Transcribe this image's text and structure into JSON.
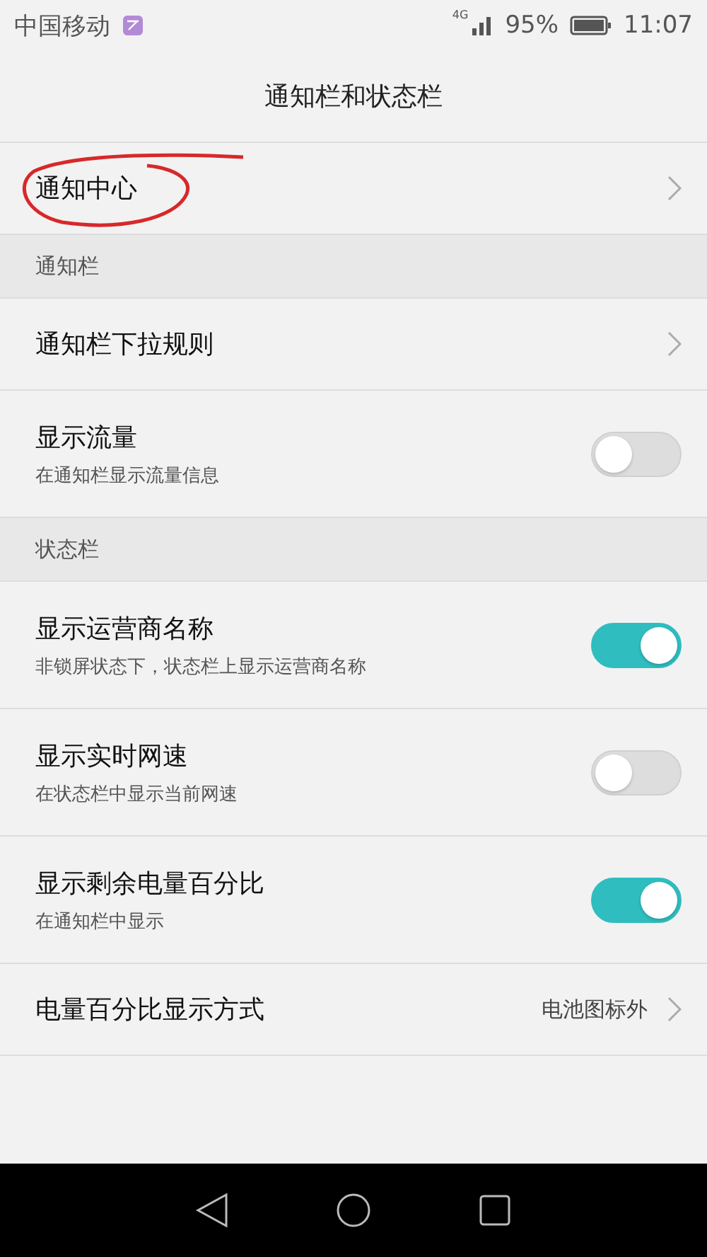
{
  "status_bar": {
    "carrier": "中国移动",
    "network": "4G",
    "battery": "95%",
    "time": "11:07"
  },
  "title": "通知栏和状态栏",
  "items": [
    {
      "kind": "link",
      "label": "通知中心",
      "annotated": true
    },
    {
      "kind": "header",
      "label": "通知栏"
    },
    {
      "kind": "link",
      "label": "通知栏下拉规则"
    },
    {
      "kind": "switch",
      "label": "显示流量",
      "subtitle": "在通知栏显示流量信息",
      "on": false
    },
    {
      "kind": "header",
      "label": "状态栏"
    },
    {
      "kind": "switch",
      "label": "显示运营商名称",
      "subtitle": "非锁屏状态下，状态栏上显示运营商名称",
      "on": true
    },
    {
      "kind": "switch",
      "label": "显示实时网速",
      "subtitle": "在状态栏中显示当前网速",
      "on": false
    },
    {
      "kind": "switch",
      "label": "显示剩余电量百分比",
      "subtitle": "在通知栏中显示",
      "on": true
    },
    {
      "kind": "link",
      "label": "电量百分比显示方式",
      "value": "电池图标外"
    }
  ]
}
